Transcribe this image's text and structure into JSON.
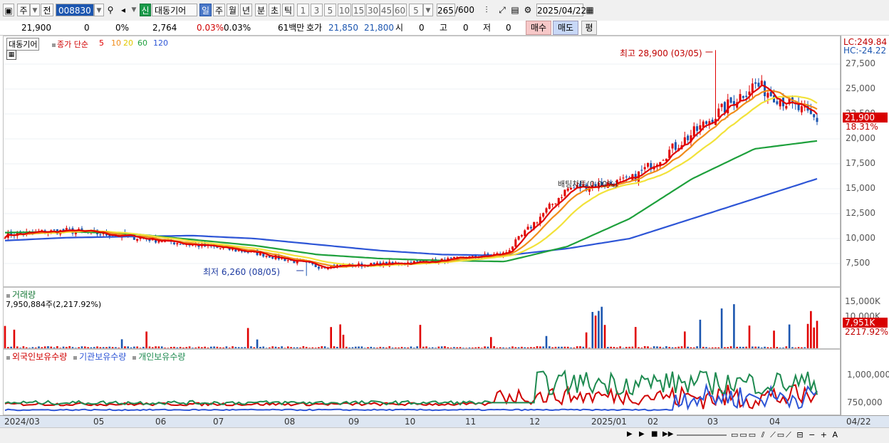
{
  "toolbar": {
    "market": "주",
    "prev_label": "전",
    "code": "008830",
    "new_label": "신",
    "name": "대동기어",
    "periods": [
      "일",
      "주",
      "월",
      "년",
      "분",
      "초",
      "틱"
    ],
    "period_active": "일",
    "intervals": [
      "1",
      "3",
      "5",
      "10",
      "15",
      "30",
      "45",
      "60"
    ],
    "interval_value": "5",
    "count": "265",
    "count_total": "/600",
    "date": "2025/04/22"
  },
  "quote": {
    "price": "21,900",
    "change": "0",
    "change_pct": "0%",
    "volume": "2,764",
    "vol_pct1": "0.03%",
    "vol_pct2": "0.03%",
    "amount": "61백만",
    "bid_label": "호가",
    "ask": "21,850",
    "bid": "21,800",
    "open_label": "시",
    "open": "0",
    "high_label": "고",
    "high": "0",
    "low_label": "저",
    "low": "0",
    "buy_label": "매수",
    "sell_label": "매도",
    "eval_label": "평"
  },
  "legend": {
    "name": "대동기어",
    "close_label": "종가 단순",
    "ma": [
      {
        "label": "5",
        "color": "#e00000"
      },
      {
        "label": "10",
        "color": "#f08c1a"
      },
      {
        "label": "20",
        "color": "#f2e23a"
      },
      {
        "label": "60",
        "color": "#1ea03c"
      },
      {
        "label": "120",
        "color": "#2d55d6"
      }
    ]
  },
  "annotations": {
    "high": "최고 28,900 (03/05)",
    "low": "최저 6,260 (08/05)",
    "mid": "배팅차트(0.00%)"
  },
  "price_axis": {
    "lc": "LC:249.84",
    "hc": "HC:-24.22",
    "ticks": [
      "27,500",
      "25,000",
      "22,500",
      "20,000",
      "17,500",
      "15,000",
      "12,500",
      "10,000",
      "7,500"
    ],
    "last_price": "21,900",
    "last_pct": "18.31%"
  },
  "volume_panel": {
    "title": "거래량",
    "info": "7,950,884주(2,217.92%)",
    "ticks": [
      "15,000K",
      "10,000K"
    ],
    "last": "7,951K",
    "last_pct": "2217.92%"
  },
  "holding_panel": {
    "series": [
      {
        "label": "외국인보유수량",
        "color": "#d00000"
      },
      {
        "label": "기관보유수량",
        "color": "#2d55d6"
      },
      {
        "label": "개인보유수량",
        "color": "#1e8a50"
      }
    ],
    "ticks": [
      "1,000,000",
      "750,000"
    ]
  },
  "x_axis": {
    "labels": [
      "2024/03",
      "05",
      "06",
      "07",
      "08",
      "09",
      "10",
      "11",
      "12",
      "2025/01",
      "02",
      "03",
      "04"
    ],
    "end_label": "04/22"
  },
  "chart_data": {
    "type": "candlestick",
    "price_range": [
      5500,
      30000
    ],
    "months": [
      "2024/03",
      "2024/04",
      "2024/05",
      "2024/06",
      "2024/07",
      "2024/08",
      "2024/09",
      "2024/10",
      "2024/11",
      "2024/12",
      "2025/01",
      "2025/02",
      "2025/03",
      "2025/04"
    ],
    "close_approx": [
      10400,
      10800,
      10200,
      9400,
      8600,
      7200,
      7400,
      7800,
      8500,
      15000,
      15800,
      20500,
      25500,
      21900
    ],
    "ma60_approx": [
      10600,
      10700,
      10500,
      9900,
      9300,
      8400,
      8000,
      7800,
      7700,
      9200,
      12000,
      16000,
      19000,
      19800
    ],
    "ma120_approx": [
      9800,
      10100,
      10200,
      10300,
      10000,
      9400,
      8800,
      8400,
      8300,
      9000,
      10000,
      12000,
      14000,
      16000
    ],
    "high": {
      "value": 28900,
      "date": "03/05"
    },
    "low": {
      "value": 6260,
      "date": "08/05"
    },
    "last_volume": "7,951K",
    "volume_range_k": [
      0,
      16500
    ],
    "holding_range": [
      620000,
      1180000
    ]
  }
}
